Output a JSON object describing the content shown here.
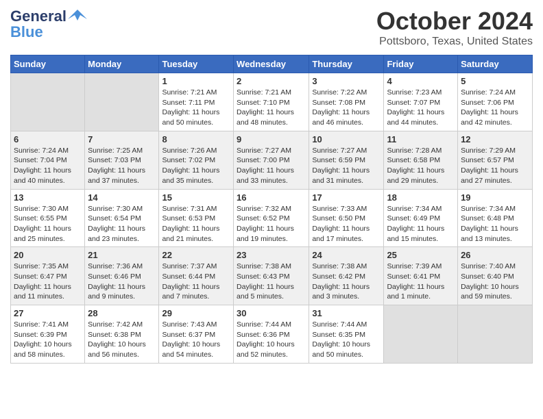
{
  "header": {
    "logo_line1": "General",
    "logo_line2": "Blue",
    "title": "October 2024",
    "subtitle": "Pottsboro, Texas, United States"
  },
  "days_of_week": [
    "Sunday",
    "Monday",
    "Tuesday",
    "Wednesday",
    "Thursday",
    "Friday",
    "Saturday"
  ],
  "weeks": [
    [
      {
        "day": "",
        "info": ""
      },
      {
        "day": "",
        "info": ""
      },
      {
        "day": "1",
        "info": "Sunrise: 7:21 AM\nSunset: 7:11 PM\nDaylight: 11 hours and 50 minutes."
      },
      {
        "day": "2",
        "info": "Sunrise: 7:21 AM\nSunset: 7:10 PM\nDaylight: 11 hours and 48 minutes."
      },
      {
        "day": "3",
        "info": "Sunrise: 7:22 AM\nSunset: 7:08 PM\nDaylight: 11 hours and 46 minutes."
      },
      {
        "day": "4",
        "info": "Sunrise: 7:23 AM\nSunset: 7:07 PM\nDaylight: 11 hours and 44 minutes."
      },
      {
        "day": "5",
        "info": "Sunrise: 7:24 AM\nSunset: 7:06 PM\nDaylight: 11 hours and 42 minutes."
      }
    ],
    [
      {
        "day": "6",
        "info": "Sunrise: 7:24 AM\nSunset: 7:04 PM\nDaylight: 11 hours and 40 minutes."
      },
      {
        "day": "7",
        "info": "Sunrise: 7:25 AM\nSunset: 7:03 PM\nDaylight: 11 hours and 37 minutes."
      },
      {
        "day": "8",
        "info": "Sunrise: 7:26 AM\nSunset: 7:02 PM\nDaylight: 11 hours and 35 minutes."
      },
      {
        "day": "9",
        "info": "Sunrise: 7:27 AM\nSunset: 7:00 PM\nDaylight: 11 hours and 33 minutes."
      },
      {
        "day": "10",
        "info": "Sunrise: 7:27 AM\nSunset: 6:59 PM\nDaylight: 11 hours and 31 minutes."
      },
      {
        "day": "11",
        "info": "Sunrise: 7:28 AM\nSunset: 6:58 PM\nDaylight: 11 hours and 29 minutes."
      },
      {
        "day": "12",
        "info": "Sunrise: 7:29 AM\nSunset: 6:57 PM\nDaylight: 11 hours and 27 minutes."
      }
    ],
    [
      {
        "day": "13",
        "info": "Sunrise: 7:30 AM\nSunset: 6:55 PM\nDaylight: 11 hours and 25 minutes."
      },
      {
        "day": "14",
        "info": "Sunrise: 7:30 AM\nSunset: 6:54 PM\nDaylight: 11 hours and 23 minutes."
      },
      {
        "day": "15",
        "info": "Sunrise: 7:31 AM\nSunset: 6:53 PM\nDaylight: 11 hours and 21 minutes."
      },
      {
        "day": "16",
        "info": "Sunrise: 7:32 AM\nSunset: 6:52 PM\nDaylight: 11 hours and 19 minutes."
      },
      {
        "day": "17",
        "info": "Sunrise: 7:33 AM\nSunset: 6:50 PM\nDaylight: 11 hours and 17 minutes."
      },
      {
        "day": "18",
        "info": "Sunrise: 7:34 AM\nSunset: 6:49 PM\nDaylight: 11 hours and 15 minutes."
      },
      {
        "day": "19",
        "info": "Sunrise: 7:34 AM\nSunset: 6:48 PM\nDaylight: 11 hours and 13 minutes."
      }
    ],
    [
      {
        "day": "20",
        "info": "Sunrise: 7:35 AM\nSunset: 6:47 PM\nDaylight: 11 hours and 11 minutes."
      },
      {
        "day": "21",
        "info": "Sunrise: 7:36 AM\nSunset: 6:46 PM\nDaylight: 11 hours and 9 minutes."
      },
      {
        "day": "22",
        "info": "Sunrise: 7:37 AM\nSunset: 6:44 PM\nDaylight: 11 hours and 7 minutes."
      },
      {
        "day": "23",
        "info": "Sunrise: 7:38 AM\nSunset: 6:43 PM\nDaylight: 11 hours and 5 minutes."
      },
      {
        "day": "24",
        "info": "Sunrise: 7:38 AM\nSunset: 6:42 PM\nDaylight: 11 hours and 3 minutes."
      },
      {
        "day": "25",
        "info": "Sunrise: 7:39 AM\nSunset: 6:41 PM\nDaylight: 11 hours and 1 minute."
      },
      {
        "day": "26",
        "info": "Sunrise: 7:40 AM\nSunset: 6:40 PM\nDaylight: 10 hours and 59 minutes."
      }
    ],
    [
      {
        "day": "27",
        "info": "Sunrise: 7:41 AM\nSunset: 6:39 PM\nDaylight: 10 hours and 58 minutes."
      },
      {
        "day": "28",
        "info": "Sunrise: 7:42 AM\nSunset: 6:38 PM\nDaylight: 10 hours and 56 minutes."
      },
      {
        "day": "29",
        "info": "Sunrise: 7:43 AM\nSunset: 6:37 PM\nDaylight: 10 hours and 54 minutes."
      },
      {
        "day": "30",
        "info": "Sunrise: 7:44 AM\nSunset: 6:36 PM\nDaylight: 10 hours and 52 minutes."
      },
      {
        "day": "31",
        "info": "Sunrise: 7:44 AM\nSunset: 6:35 PM\nDaylight: 10 hours and 50 minutes."
      },
      {
        "day": "",
        "info": ""
      },
      {
        "day": "",
        "info": ""
      }
    ]
  ],
  "colors": {
    "header_bg": "#3a6bbf",
    "header_text": "#ffffff",
    "row_odd": "#ffffff",
    "row_even": "#f0f0f0",
    "empty_cell": "#e0e0e0"
  }
}
